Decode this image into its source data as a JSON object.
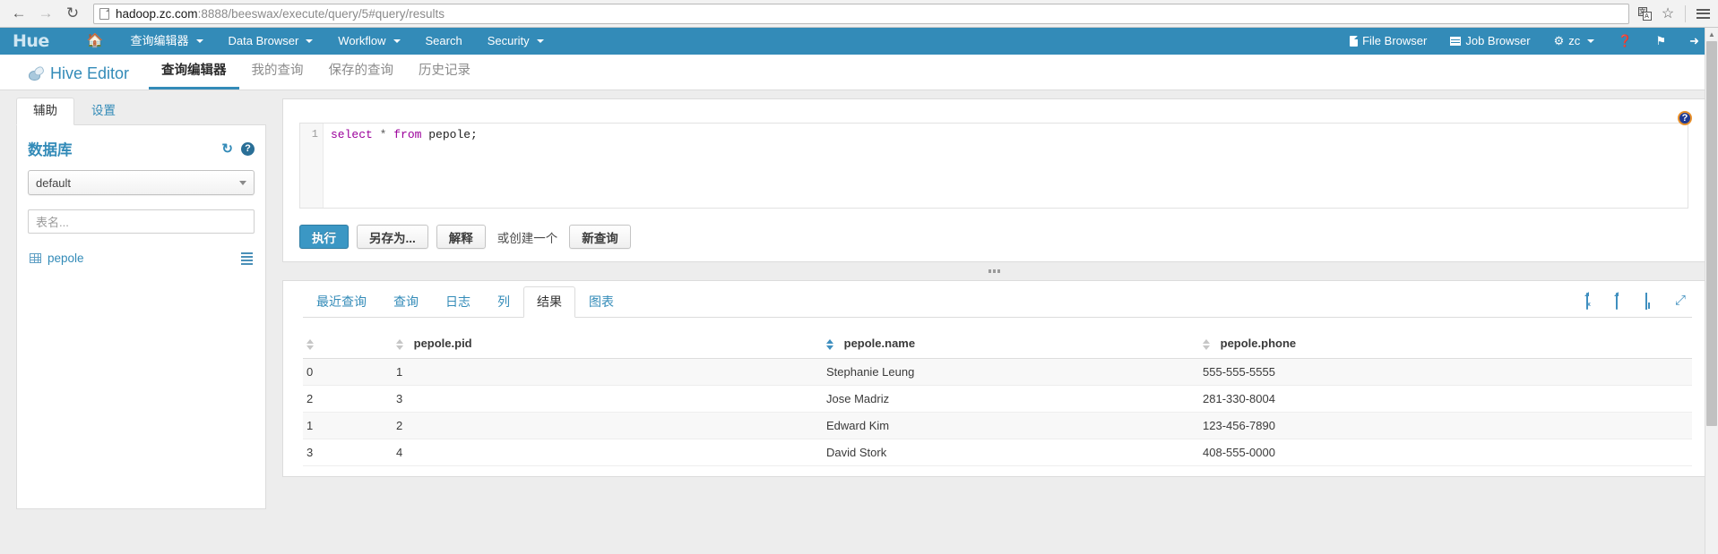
{
  "browser": {
    "back_icon": "back-arrow-icon",
    "forward_icon": "forward-arrow-icon",
    "reload_icon": "reload-icon",
    "url_host": "hadoop.zc.com",
    "url_rest": ":8888/beeswax/execute/query/5#query/results",
    "translate_icon": "translate-icon",
    "bookmark_icon": "star-icon",
    "menu_icon": "hamburger-menu-icon"
  },
  "navbar": {
    "logo": "Hue",
    "home_icon": "home-icon",
    "items": [
      {
        "label": "查询编辑器",
        "caret": true
      },
      {
        "label": "Data Browser",
        "caret": true
      },
      {
        "label": "Workflow",
        "caret": true
      },
      {
        "label": "Search",
        "caret": false
      },
      {
        "label": "Security",
        "caret": true
      }
    ],
    "right_items": [
      {
        "label": "File Browser",
        "icon": "file-browser-icon"
      },
      {
        "label": "Job Browser",
        "icon": "job-browser-icon"
      },
      {
        "label": "zc",
        "icon": "gear-icon",
        "caret": true
      }
    ],
    "help_icon": "question-circle-icon",
    "flag_icon": "flag-icon",
    "logout_icon": "logout-icon",
    "bg_color": "#338bb8"
  },
  "subheader": {
    "app_title": "Hive Editor",
    "app_icon": "beeswax-icon",
    "tabs": [
      {
        "label": "查询编辑器",
        "active": true
      },
      {
        "label": "我的查询",
        "active": false
      },
      {
        "label": "保存的查询",
        "active": false
      },
      {
        "label": "历史记录",
        "active": false
      }
    ]
  },
  "sidebar": {
    "tabs": [
      {
        "label": "辅助",
        "active": true
      },
      {
        "label": "设置",
        "active": false
      }
    ],
    "database_label": "数据库",
    "refresh_icon": "refresh-icon",
    "help_icon": "help-circle-icon",
    "database_selected": "default",
    "table_filter_placeholder": "表名...",
    "tables": [
      {
        "name": "pepole",
        "icon": "table-icon",
        "menu_icon": "list-menu-icon"
      }
    ]
  },
  "editor": {
    "help_icon": "help-circle-icon",
    "line_number": "1",
    "sql_keyword_1": "select",
    "sql_operator": " * ",
    "sql_keyword_2": "from",
    "sql_rest": " pepole;",
    "buttons": {
      "execute": "执行",
      "save_as": "另存为...",
      "explain": "解释",
      "note": "或创建一个",
      "new_query": "新查询"
    },
    "splitter_icon": "drag-handle-icon"
  },
  "results": {
    "tabs": [
      {
        "label": "最近查询",
        "active": false
      },
      {
        "label": "查询",
        "active": false
      },
      {
        "label": "日志",
        "active": false
      },
      {
        "label": "列",
        "active": false
      },
      {
        "label": "结果",
        "active": true
      },
      {
        "label": "图表",
        "active": false
      }
    ],
    "export": [
      {
        "name": "export-excel-icon",
        "glyph": "x"
      },
      {
        "name": "export-csv-icon",
        "glyph": ""
      },
      {
        "name": "save-results-icon",
        "glyph": ""
      },
      {
        "name": "expand-icon",
        "glyph": "⤢"
      }
    ],
    "columns": [
      {
        "label": "",
        "sorted": false
      },
      {
        "label": "pepole.pid",
        "sorted": false
      },
      {
        "label": "pepole.name",
        "sorted": true
      },
      {
        "label": "pepole.phone",
        "sorted": false
      }
    ],
    "rows": [
      {
        "idx": "0",
        "pid": "1",
        "name": "Stephanie Leung",
        "phone": "555-555-5555"
      },
      {
        "idx": "2",
        "pid": "3",
        "name": "Jose Madriz",
        "phone": "281-330-8004"
      },
      {
        "idx": "1",
        "pid": "2",
        "name": "Edward Kim",
        "phone": "123-456-7890"
      },
      {
        "idx": "3",
        "pid": "4",
        "name": "David Stork",
        "phone": "408-555-0000"
      }
    ]
  }
}
